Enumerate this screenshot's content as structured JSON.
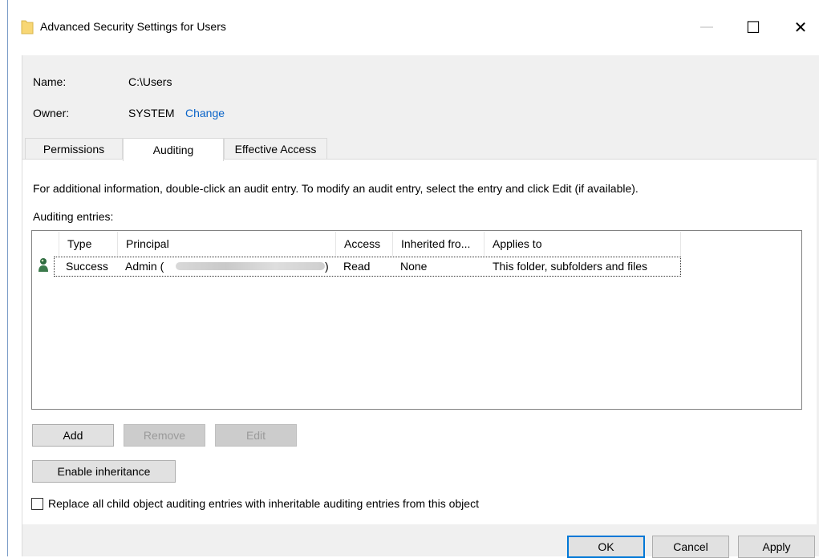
{
  "window": {
    "title": "Advanced Security Settings for Users",
    "minimize_glyph": "—",
    "maximize_glyph": "☐",
    "close_glyph": "✕"
  },
  "info": {
    "name_label": "Name:",
    "name_value": "C:\\Users",
    "owner_label": "Owner:",
    "owner_value": "SYSTEM",
    "change_link": "Change"
  },
  "tabs": [
    {
      "label": "Permissions",
      "active": false
    },
    {
      "label": "Auditing",
      "active": true
    },
    {
      "label": "Effective Access",
      "active": false
    }
  ],
  "auditing": {
    "description": "For additional information, double-click an audit entry. To modify an audit entry, select the entry and click Edit (if available).",
    "entries_label": "Auditing entries:",
    "columns": [
      "Type",
      "Principal",
      "Access",
      "Inherited fro...",
      "Applies to"
    ],
    "rows": [
      {
        "type": "Success",
        "principal_start": "Admin (",
        "principal_end": ")",
        "access": "Read",
        "inherited_from": "None",
        "applies_to": "This folder, subfolders and files",
        "icon": "user-icon"
      }
    ]
  },
  "buttons": {
    "add": "Add",
    "remove": "Remove",
    "edit": "Edit",
    "enable_inheritance": "Enable inheritance",
    "ok": "OK",
    "cancel": "Cancel",
    "apply": "Apply"
  },
  "checkbox": {
    "label": "Replace all child object auditing entries with inheritable auditing entries from this object",
    "checked": false
  },
  "colors": {
    "link": "#0a64c8",
    "focus_border": "#0078d7",
    "folder": "#f8d775"
  }
}
